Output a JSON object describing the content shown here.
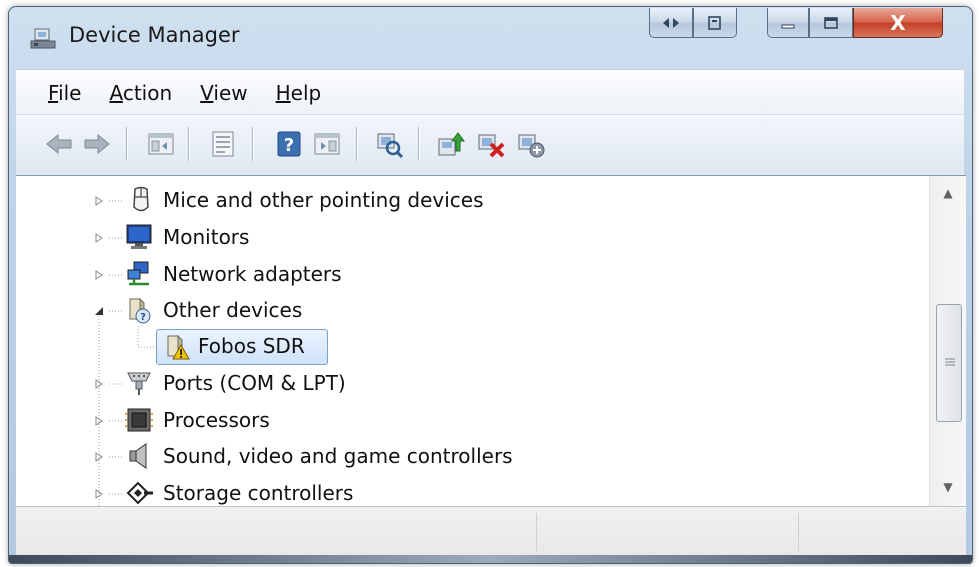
{
  "window": {
    "title": "Device Manager"
  },
  "menu": {
    "items": [
      {
        "label": "File",
        "accel": "F",
        "rest": "ile"
      },
      {
        "label": "Action",
        "accel": "A",
        "rest": "ction"
      },
      {
        "label": "View",
        "accel": "V",
        "rest": "iew"
      },
      {
        "label": "Help",
        "accel": "H",
        "rest": "elp"
      }
    ]
  },
  "toolbar": {
    "icons": [
      "back-arrow-icon",
      "forward-arrow-icon",
      "show-hide-console-tree-icon",
      "properties-icon",
      "help-icon",
      "show-hide-action-pane-icon",
      "scan-hardware-changes-icon",
      "update-driver-icon",
      "uninstall-device-icon",
      "disable-device-icon"
    ]
  },
  "tree": {
    "items": [
      {
        "label": "Mice and other pointing devices",
        "icon": "mouse-icon",
        "state": "collapsed"
      },
      {
        "label": "Monitors",
        "icon": "monitor-icon",
        "state": "collapsed"
      },
      {
        "label": "Network adapters",
        "icon": "network-adapter-icon",
        "state": "collapsed"
      },
      {
        "label": "Other devices",
        "icon": "unknown-device-icon",
        "state": "expanded"
      },
      {
        "label": "Fobos SDR",
        "icon": "warning-device-icon",
        "state": "child-selected"
      },
      {
        "label": "Ports (COM & LPT)",
        "icon": "port-icon",
        "state": "collapsed"
      },
      {
        "label": "Processors",
        "icon": "processor-icon",
        "state": "collapsed"
      },
      {
        "label": "Sound, video and game controllers",
        "icon": "speaker-icon",
        "state": "collapsed"
      },
      {
        "label": "Storage controllers",
        "icon": "storage-controller-icon",
        "state": "collapsed"
      }
    ]
  },
  "colors": {
    "titlebar": "#bcd2e8",
    "close": "#c23f24",
    "selection": "#cfe3fb",
    "warning": "#f2c200"
  }
}
